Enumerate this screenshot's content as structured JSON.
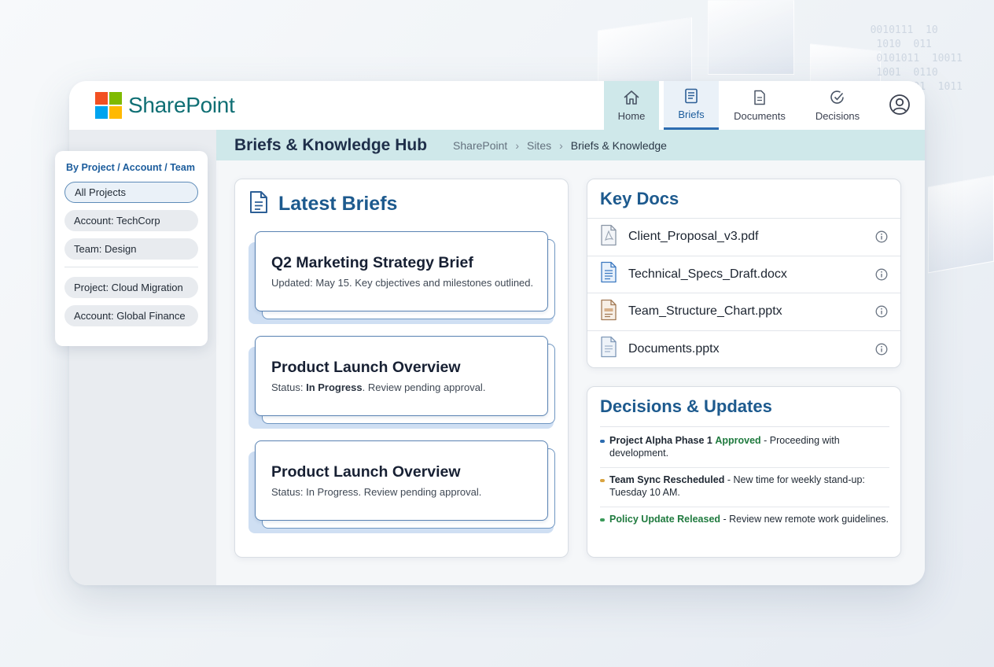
{
  "app": {
    "name": "SharePoint",
    "logo_colors": [
      "#f25022",
      "#7fba00",
      "#00a4ef",
      "#ffb900"
    ]
  },
  "nav": {
    "items": [
      {
        "label": "Home",
        "icon": "home-icon"
      },
      {
        "label": "Briefs",
        "icon": "document-icon",
        "selected": true
      },
      {
        "label": "Documents",
        "icon": "file-icon"
      },
      {
        "label": "Decisions",
        "icon": "check-circle-icon"
      }
    ],
    "user_icon": "user-icon"
  },
  "header": {
    "title": "Briefs & Knowledge Hub",
    "breadcrumb": [
      "SharePoint",
      "Sites",
      "Briefs & Knowledge"
    ]
  },
  "filters": {
    "title": "By Project / Account / Team",
    "items": [
      {
        "label": "All Projects",
        "active": true
      },
      {
        "label": "Account: TechCorp"
      },
      {
        "label": "Team: Design"
      },
      {
        "label": "Project: Cloud Migration"
      },
      {
        "label": "Account: Global Finance"
      }
    ]
  },
  "briefs": {
    "title": "Latest Briefs",
    "items": [
      {
        "title": "Q2 Marketing Strategy Brief",
        "subtitle": "Updated: May 15. Key cbjectives and milestones outlined."
      },
      {
        "title": "Product Launch Overview",
        "status_prefix": "Status: ",
        "status_value": "In Progress",
        "status_suffix": ". Review pending approval."
      },
      {
        "title": "Product Launch Overview",
        "subtitle": "Status: In Progress. Review pending approval."
      }
    ]
  },
  "key_docs": {
    "title": "Key Docs",
    "items": [
      {
        "name": "Client_Proposal_v3.pdf",
        "icon": "pdf-file-icon"
      },
      {
        "name": "Technical_Specs_Draft.docx",
        "icon": "word-file-icon"
      },
      {
        "name": "Team_Structure_Chart.pptx",
        "icon": "slides-file-icon"
      },
      {
        "name": "Documents.pptx",
        "icon": "file-icon"
      }
    ]
  },
  "decisions": {
    "title": "Decisions & Updates",
    "items": [
      {
        "lead": "Project Alpha Phase 1",
        "highlight": "Approved",
        "text": " - Proceeding with development.",
        "dot_color": "#2d6cb0"
      },
      {
        "lead": "Team Sync Rescheduled",
        "text": " - New time for weekly stand-up: Tuesday 10 AM.",
        "dot_color": "#d9a441"
      },
      {
        "highlight": "Policy Update Released",
        "text": " - Review new remote work guidelines.",
        "dot_color": "#3b9a5a"
      }
    ]
  }
}
